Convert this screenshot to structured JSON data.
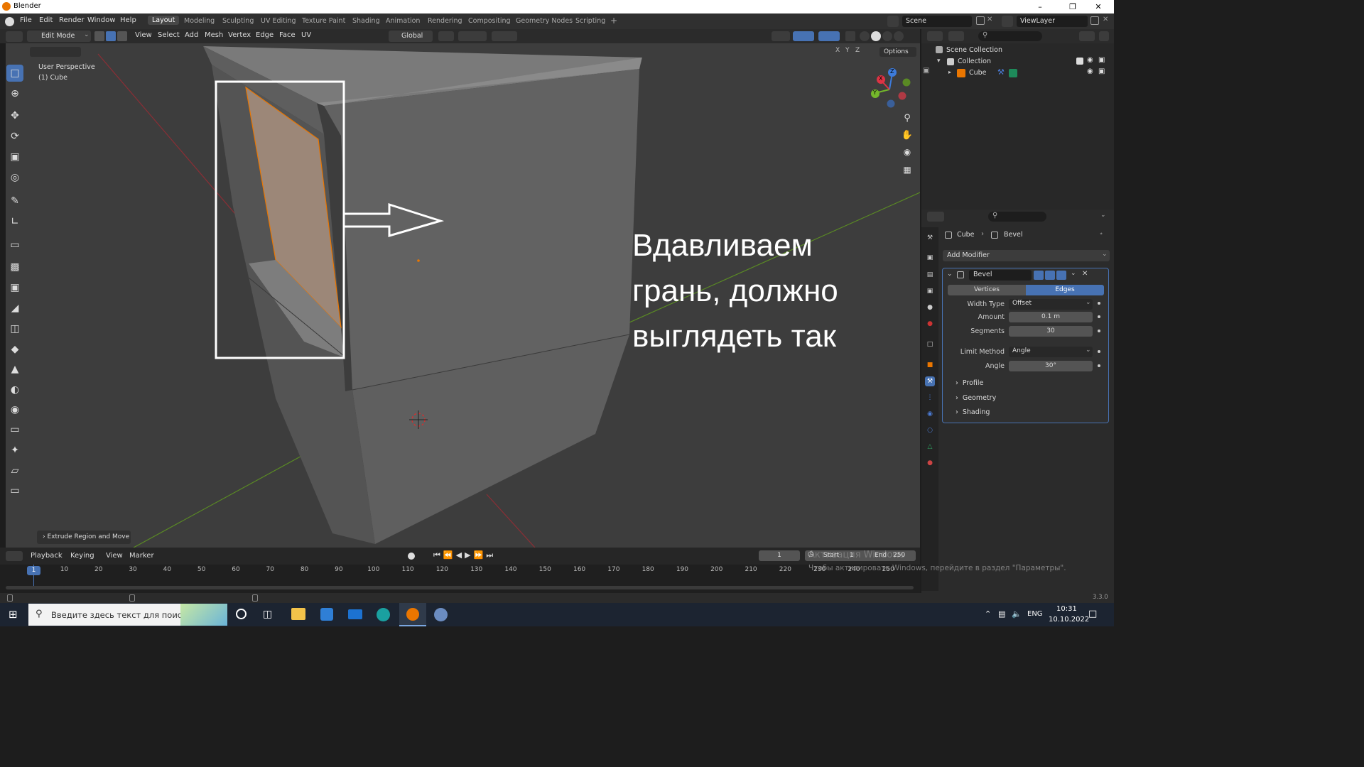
{
  "window": {
    "title": "Blender"
  },
  "menubar": {
    "menus": [
      "File",
      "Edit",
      "Render",
      "Window",
      "Help"
    ],
    "workspaces": [
      "Layout",
      "Modeling",
      "Sculpting",
      "UV Editing",
      "Texture Paint",
      "Shading",
      "Animation",
      "Rendering",
      "Compositing",
      "Geometry Nodes",
      "Scripting"
    ],
    "active_workspace": "Layout",
    "add_tab": "+",
    "scene": "Scene",
    "view_layer": "ViewLayer"
  },
  "viewport_header": {
    "mode": "Edit Mode",
    "menus": [
      "View",
      "Select",
      "Add",
      "Mesh",
      "Vertex",
      "Edge",
      "Face",
      "UV"
    ],
    "orientation": "Global",
    "axes": [
      "X",
      "Y",
      "Z"
    ],
    "options": "Options"
  },
  "viewport": {
    "perspective": "User Perspective",
    "object": "(1) Cube",
    "annotation_lines": [
      "Вдавливаем",
      "грань, должно",
      "выглядеть так"
    ],
    "last_operator": "Extrude Region and Move",
    "gizmo": {
      "x": "X",
      "y": "Y",
      "z": "Z"
    }
  },
  "outliner": {
    "scene_collection": "Scene Collection",
    "collection": "Collection",
    "object": "Cube"
  },
  "properties": {
    "breadcrumb_object": "Cube",
    "breadcrumb_modifier": "Bevel",
    "add_modifier": "Add Modifier",
    "modifier_name": "Bevel",
    "affect_options": [
      "Vertices",
      "Edges"
    ],
    "affect_selected": "Edges",
    "rows": [
      {
        "label": "Width Type",
        "value": "Offset"
      },
      {
        "label": "Amount",
        "value": "0.1 m"
      },
      {
        "label": "Segments",
        "value": "30"
      },
      {
        "label": "Limit Method",
        "value": "Angle"
      },
      {
        "label": "Angle",
        "value": "30°"
      }
    ],
    "panels": [
      "Profile",
      "Geometry",
      "Shading"
    ]
  },
  "timeline": {
    "menus": [
      "Playback",
      "Keying",
      "View",
      "Marker"
    ],
    "current_frame": "1",
    "start_label": "Start",
    "start": "1",
    "end_label": "End",
    "end": "250",
    "ruler": [
      "1",
      "10",
      "20",
      "30",
      "40",
      "50",
      "60",
      "70",
      "80",
      "90",
      "100",
      "110",
      "120",
      "130",
      "140",
      "150",
      "160",
      "170",
      "180",
      "190",
      "200",
      "210",
      "220",
      "230",
      "240",
      "250"
    ],
    "playhead_label": "1"
  },
  "statusbar": {
    "version": "3.3.0"
  },
  "watermark": {
    "line1": "Активация Windows",
    "line2": "Чтобы активировать Windows, перейдите в раздел \"Параметры\"."
  },
  "taskbar": {
    "search_placeholder": "Введите здесь текст для поиска",
    "language": "ENG",
    "time": "10:31",
    "date": "10.10.2022"
  },
  "colors": {
    "accent": "#4772b3",
    "selection": "#ea7600",
    "x_axis": "#dd3344",
    "y_axis": "#74b82b",
    "z_axis": "#3d7bdb"
  }
}
